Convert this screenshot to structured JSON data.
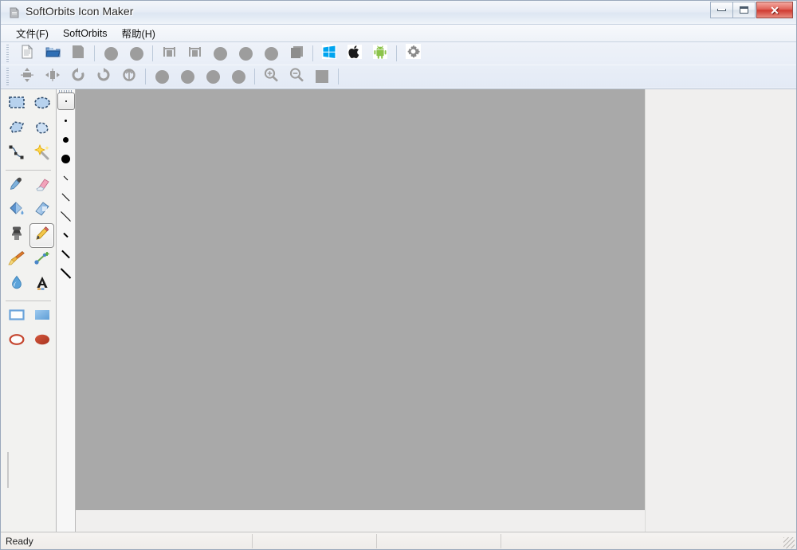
{
  "window": {
    "title": "SoftOrbits Icon Maker",
    "app_icon": "app-document-icon",
    "controls": {
      "minimize_label": "",
      "maximize_label": "",
      "close_label": "✕"
    }
  },
  "menu": {
    "items": [
      {
        "label": "文件(F)",
        "name": "menu-file"
      },
      {
        "label": "SoftOrbits",
        "name": "menu-softorbits"
      },
      {
        "label": "帮助(H)",
        "name": "menu-help"
      }
    ]
  },
  "toolbar": {
    "row1": [
      {
        "name": "new-document-button",
        "icon": "new-document-icon",
        "type": "image"
      },
      {
        "name": "open-file-button",
        "icon": "open-folder-icon",
        "type": "image"
      },
      {
        "name": "save-file-button",
        "icon": "save-disk-icon",
        "type": "disc-square"
      },
      {
        "sep": true
      },
      {
        "name": "undo-button",
        "icon": "undo-icon",
        "type": "disc"
      },
      {
        "name": "redo-button",
        "icon": "redo-icon",
        "type": "disc"
      },
      {
        "sep": true
      },
      {
        "name": "cut-button",
        "icon": "cut-icon",
        "type": "frame"
      },
      {
        "name": "copy-button",
        "icon": "copy-icon",
        "type": "frame"
      },
      {
        "name": "paste-button",
        "icon": "paste-icon",
        "type": "disc"
      },
      {
        "name": "delete-button",
        "icon": "delete-icon",
        "type": "disc"
      },
      {
        "name": "duplicate-button",
        "icon": "duplicate-icon",
        "type": "disc"
      },
      {
        "name": "layers-button",
        "icon": "layers-icon",
        "type": "pages"
      },
      {
        "sep": true
      },
      {
        "name": "export-windows-button",
        "icon": "windows-logo-icon",
        "type": "windows"
      },
      {
        "name": "export-apple-button",
        "icon": "apple-logo-icon",
        "type": "apple"
      },
      {
        "name": "export-android-button",
        "icon": "android-logo-icon",
        "type": "android"
      },
      {
        "sep": true
      },
      {
        "name": "settings-button",
        "icon": "gear-icon",
        "type": "gear"
      }
    ],
    "row2": [
      {
        "name": "flip-vertical-button",
        "icon": "flip-vertical-icon",
        "type": "flipv"
      },
      {
        "name": "flip-horizontal-button",
        "icon": "flip-horizontal-icon",
        "type": "fliph"
      },
      {
        "name": "rotate-left-button",
        "icon": "rotate-left-icon",
        "type": "rotl"
      },
      {
        "name": "rotate-right-button",
        "icon": "rotate-right-icon",
        "type": "rotr"
      },
      {
        "name": "rotate-free-button",
        "icon": "rotate-free-icon",
        "type": "rotf"
      },
      {
        "sep": true
      },
      {
        "name": "resize-canvas-button",
        "icon": "resize-canvas-icon",
        "type": "disc"
      },
      {
        "name": "crop-button",
        "icon": "crop-icon",
        "type": "disc"
      },
      {
        "name": "effects-button",
        "icon": "effects-icon",
        "type": "disc"
      },
      {
        "name": "filters-button",
        "icon": "filters-icon",
        "type": "disc"
      },
      {
        "sep": true
      },
      {
        "name": "zoom-in-button",
        "icon": "zoom-in-icon",
        "type": "zoomin"
      },
      {
        "name": "zoom-out-button",
        "icon": "zoom-out-icon",
        "type": "zoomout"
      },
      {
        "name": "actual-size-button",
        "icon": "actual-size-icon",
        "type": "sq"
      },
      {
        "sep": true
      }
    ]
  },
  "tool_palette": {
    "groups": [
      {
        "name": "selection-tools",
        "tools": [
          {
            "name": "tool-rectangle-select",
            "icon": "rectangle-select-icon",
            "selected": false
          },
          {
            "name": "tool-ellipse-select",
            "icon": "ellipse-select-icon",
            "selected": false
          },
          {
            "name": "tool-lasso-select",
            "icon": "lasso-select-icon",
            "selected": false
          },
          {
            "name": "tool-free-select",
            "icon": "free-select-icon",
            "selected": false
          },
          {
            "name": "tool-path",
            "icon": "path-node-icon",
            "selected": false
          },
          {
            "name": "tool-magic-wand",
            "icon": "magic-wand-icon",
            "selected": false
          }
        ]
      },
      {
        "name": "paint-tools",
        "tools": [
          {
            "name": "tool-color-picker",
            "icon": "eyedropper-icon",
            "selected": false
          },
          {
            "name": "tool-eraser",
            "icon": "eraser-icon",
            "selected": false
          },
          {
            "name": "tool-paint-bucket",
            "icon": "paint-bucket-icon",
            "selected": false
          },
          {
            "name": "tool-gradient",
            "icon": "gradient-icon",
            "selected": false
          },
          {
            "name": "tool-clone-stamp",
            "icon": "clone-stamp-icon",
            "selected": false
          },
          {
            "name": "tool-pencil",
            "icon": "pencil-icon",
            "selected": true
          },
          {
            "name": "tool-brush",
            "icon": "paintbrush-icon",
            "selected": false
          },
          {
            "name": "tool-heal",
            "icon": "heal-plus-icon",
            "selected": false
          },
          {
            "name": "tool-blur",
            "icon": "water-drop-icon",
            "selected": false
          },
          {
            "name": "tool-text",
            "icon": "text-a-icon",
            "selected": false
          }
        ]
      },
      {
        "name": "shape-tools",
        "tools": [
          {
            "name": "tool-rectangle-outline",
            "icon": "rectangle-outline-icon",
            "selected": false
          },
          {
            "name": "tool-rectangle-filled",
            "icon": "rectangle-filled-icon",
            "selected": false
          },
          {
            "name": "tool-ellipse-outline",
            "icon": "ellipse-outline-icon",
            "selected": false
          },
          {
            "name": "tool-ellipse-filled",
            "icon": "ellipse-filled-icon",
            "selected": false
          }
        ]
      }
    ]
  },
  "brush_strip": {
    "items": [
      {
        "name": "brush-size-pixel",
        "shape": "pixel",
        "size": 2,
        "selected": true
      },
      {
        "name": "brush-size-tiny",
        "shape": "dot",
        "size": 3,
        "selected": false
      },
      {
        "name": "brush-size-small",
        "shape": "dot",
        "size": 7,
        "selected": false
      },
      {
        "name": "brush-size-medium",
        "shape": "dot",
        "size": 11,
        "selected": false
      },
      {
        "name": "brush-stroke-1",
        "shape": "dash",
        "size": 7,
        "thickness": 1,
        "selected": false
      },
      {
        "name": "brush-stroke-2",
        "shape": "dash",
        "size": 13,
        "thickness": 1,
        "selected": false
      },
      {
        "name": "brush-stroke-3",
        "shape": "dash",
        "size": 17,
        "thickness": 1,
        "selected": false
      },
      {
        "name": "brush-stroke-4",
        "shape": "dash",
        "size": 7,
        "thickness": 2,
        "selected": false
      },
      {
        "name": "brush-stroke-5",
        "shape": "dash",
        "size": 13,
        "thickness": 2,
        "selected": false
      },
      {
        "name": "brush-stroke-6",
        "shape": "dash",
        "size": 17,
        "thickness": 2,
        "selected": false
      }
    ]
  },
  "canvas": {
    "background_color": "#a9a9a9",
    "panel_color": "#f0efee"
  },
  "status_bar": {
    "ready_text": "Ready",
    "cell2": "",
    "cell3": "",
    "cell4": ""
  },
  "colors": {
    "accent": "#3d7cc9",
    "windows_blue": "#0d9ee5",
    "android_green": "#8bc34a",
    "close_red": "#cf3a30",
    "canvas_gray": "#a9a9a9"
  }
}
